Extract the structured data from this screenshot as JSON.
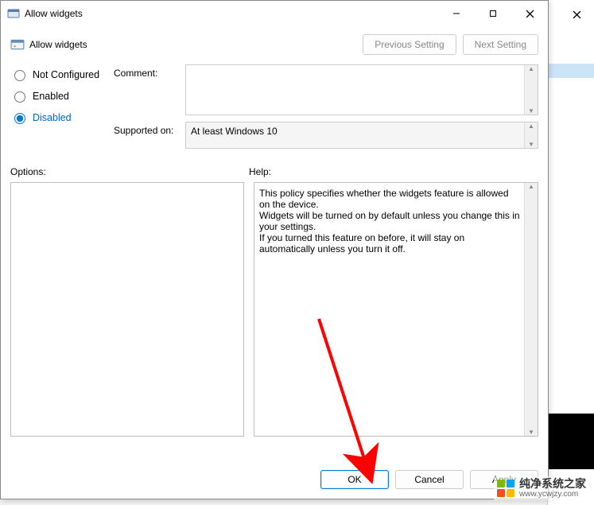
{
  "window": {
    "title": "Allow widgets"
  },
  "subheader": {
    "title": "Allow widgets"
  },
  "nav": {
    "previous": "Previous Setting",
    "next": "Next Setting"
  },
  "radios": {
    "not_configured": "Not Configured",
    "enabled": "Enabled",
    "disabled": "Disabled",
    "selected": "disabled"
  },
  "fields": {
    "comment_label": "Comment:",
    "comment_value": "",
    "supported_label": "Supported on:",
    "supported_value": "At least Windows 10"
  },
  "labels": {
    "options": "Options:",
    "help": "Help:"
  },
  "help_text": "This policy specifies whether the widgets feature is allowed on the device.\nWidgets will be turned on by default unless you change this in your settings.\nIf you turned this feature on before, it will stay on automatically unless you turn it off.",
  "footer": {
    "ok": "OK",
    "cancel": "Cancel",
    "apply": "Apply"
  },
  "watermark": {
    "text": "纯净系统之家",
    "url": "www.ycwjzy.com",
    "colors": [
      "#7fba00",
      "#00a4ef",
      "#f25022",
      "#ffb900"
    ]
  }
}
